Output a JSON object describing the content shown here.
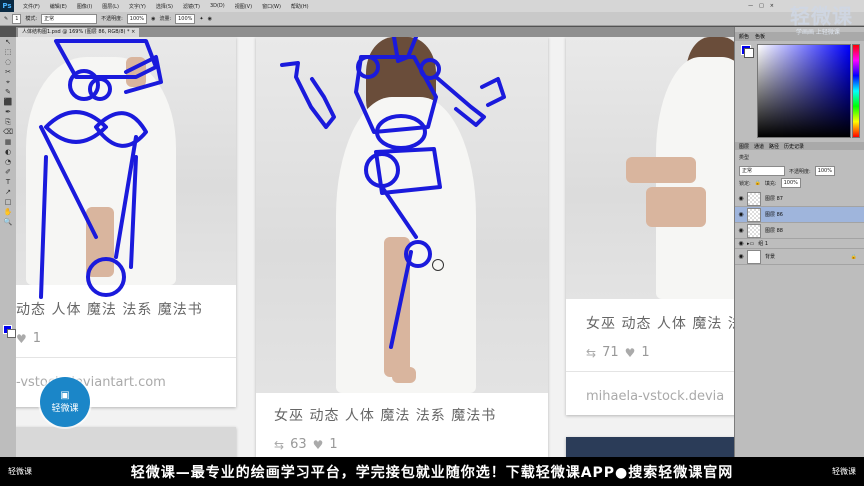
{
  "app": {
    "logo": "Ps",
    "menus": [
      "文件(F)",
      "编辑(E)",
      "图像(I)",
      "图层(L)",
      "文字(Y)",
      "选择(S)",
      "滤镜(T)",
      "3D(D)",
      "视图(V)",
      "窗口(W)",
      "帮助(H)"
    ],
    "window_buttons": [
      "—",
      "□",
      "×"
    ]
  },
  "options_bar": {
    "mode_label": "模式:",
    "mode_value": "正常",
    "opacity_label": "不透明度:",
    "opacity_value": "100%",
    "flow_label": "流量:",
    "flow_value": "100%",
    "brush_size": "1"
  },
  "document_tab": {
    "title": "人体结构图1.psd @ 169% (图层 86, RGB/8) *",
    "close": "×"
  },
  "tools": [
    "↖",
    "⬚",
    "◌",
    "✂",
    "⌖",
    "✎",
    "⬛",
    "✒",
    "⎘",
    "⌫",
    "▦",
    "◐",
    "◔",
    "✐",
    "T",
    "↗",
    "□",
    "✋",
    "🔍"
  ],
  "cards": [
    {
      "title": "动态 人体 魔法 法系 魔法书",
      "likes": "1",
      "site": "-vstock.deviantart.com"
    },
    {
      "title": "女巫 动态 人体 魔法 法系 魔法书",
      "repins": "63",
      "likes": "1",
      "site": ""
    },
    {
      "title": "女巫 动态 人体 魔法 法",
      "repins": "71",
      "likes": "1",
      "site": "mihaela-vstock.devia"
    }
  ],
  "right_panel": {
    "tabs": [
      "颜色",
      "色板"
    ],
    "layers_tabs": [
      "图层",
      "通道",
      "路径",
      "历史记录"
    ],
    "kind_label": "类型",
    "blend_value": "正常",
    "opacity_label": "不透明度:",
    "opacity_value": "100%",
    "lock_label": "锁定:",
    "fill_label": "填充:",
    "fill_value": "100%",
    "layers": [
      {
        "name": "图层 87",
        "selected": false
      },
      {
        "name": "图层 86",
        "selected": true
      },
      {
        "name": "图层 88",
        "selected": false
      },
      {
        "name": "组 1",
        "selected": false
      },
      {
        "name": "背景",
        "selected": false
      }
    ]
  },
  "watermark": {
    "title": "轻微课",
    "subtitle": "学画画 上轻微课"
  },
  "logo_badge": {
    "text": "轻微课"
  },
  "banner": {
    "left_logo": "轻微课",
    "text": "轻微课—最专业的绘画学习平台，学完接包就业随你选！下载轻微课APP●搜索轻微课官网",
    "right_logo": "轻微课"
  },
  "colors": {
    "stroke": "#1a1adc",
    "foreground": "#0000ee",
    "ps_chrome": "#bdbdbd",
    "banner_bg": "#000000",
    "logo_bg": "#1b86c8"
  }
}
